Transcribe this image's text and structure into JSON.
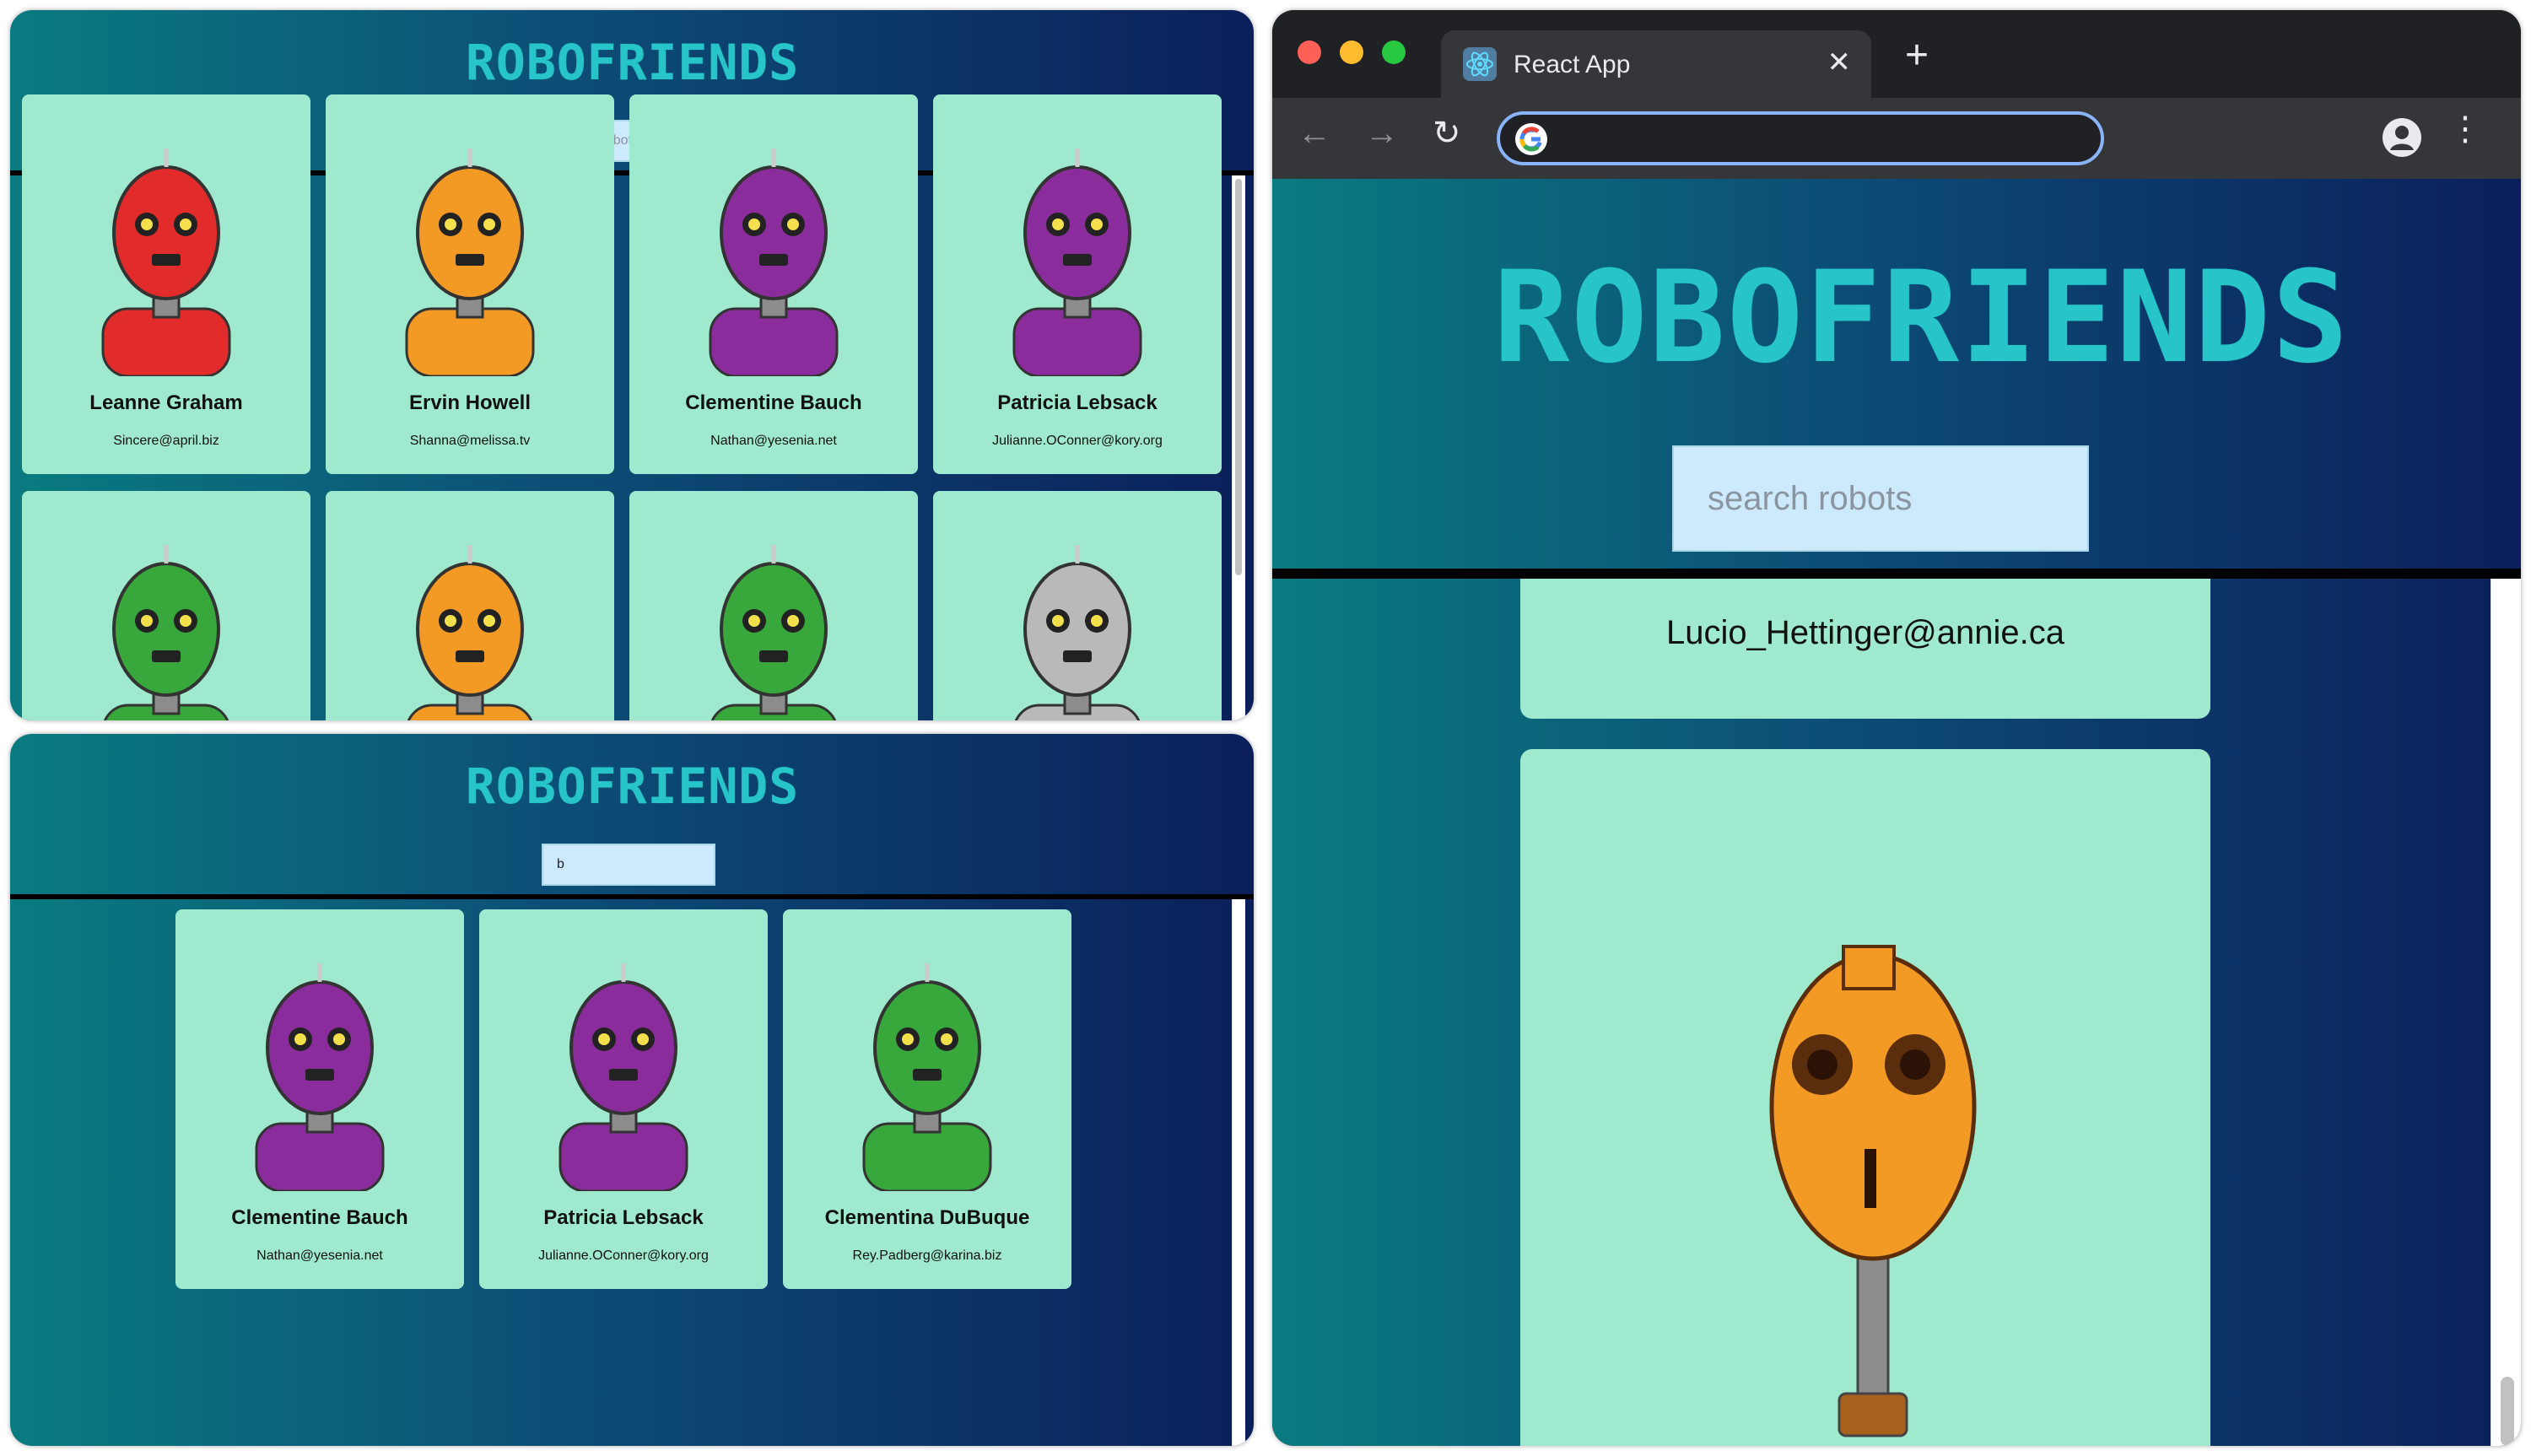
{
  "app": {
    "logo": "ROBOFRIENDS",
    "search_placeholder": "search robots"
  },
  "panel_top": {
    "search_value": "",
    "cards": [
      {
        "name": "Leanne Graham",
        "email": "Sincere@april.biz",
        "color": "#e22b2b"
      },
      {
        "name": "Ervin Howell",
        "email": "Shanna@melissa.tv",
        "color": "#f39a25"
      },
      {
        "name": "Clementine Bauch",
        "email": "Nathan@yesenia.net",
        "color": "#8a2c9c"
      },
      {
        "name": "Patricia Lebsack",
        "email": "Julianne.OConner@kory.org",
        "color": "#8a2c9c"
      },
      {
        "name": "",
        "email": "",
        "color": "#38a83c"
      },
      {
        "name": "",
        "email": "",
        "color": "#f39a25"
      },
      {
        "name": "",
        "email": "",
        "color": "#38a83c"
      },
      {
        "name": "",
        "email": "",
        "color": "#b9b9b9"
      }
    ]
  },
  "panel_bottom": {
    "search_value": "b",
    "cards": [
      {
        "name": "Clementine Bauch",
        "email": "Nathan@yesenia.net",
        "color": "#8a2c9c"
      },
      {
        "name": "Patricia Lebsack",
        "email": "Julianne.OConner@kory.org",
        "color": "#8a2c9c"
      },
      {
        "name": "Clementina DuBuque",
        "email": "Rey.Padberg@karina.biz",
        "color": "#38a83c"
      }
    ]
  },
  "browser": {
    "tab_title": "React App",
    "tab_close": "✕",
    "new_tab": "+",
    "back": "←",
    "forward": "→",
    "reload": "↻",
    "address_value": "",
    "kebab": "⋮",
    "colors": {
      "close": "#fe5f57",
      "minimize": "#febc2e",
      "zoom": "#28c840"
    },
    "top_card_email": "Lucio_Hettinger@annie.ca",
    "big_card_color": "#f39a25"
  }
}
